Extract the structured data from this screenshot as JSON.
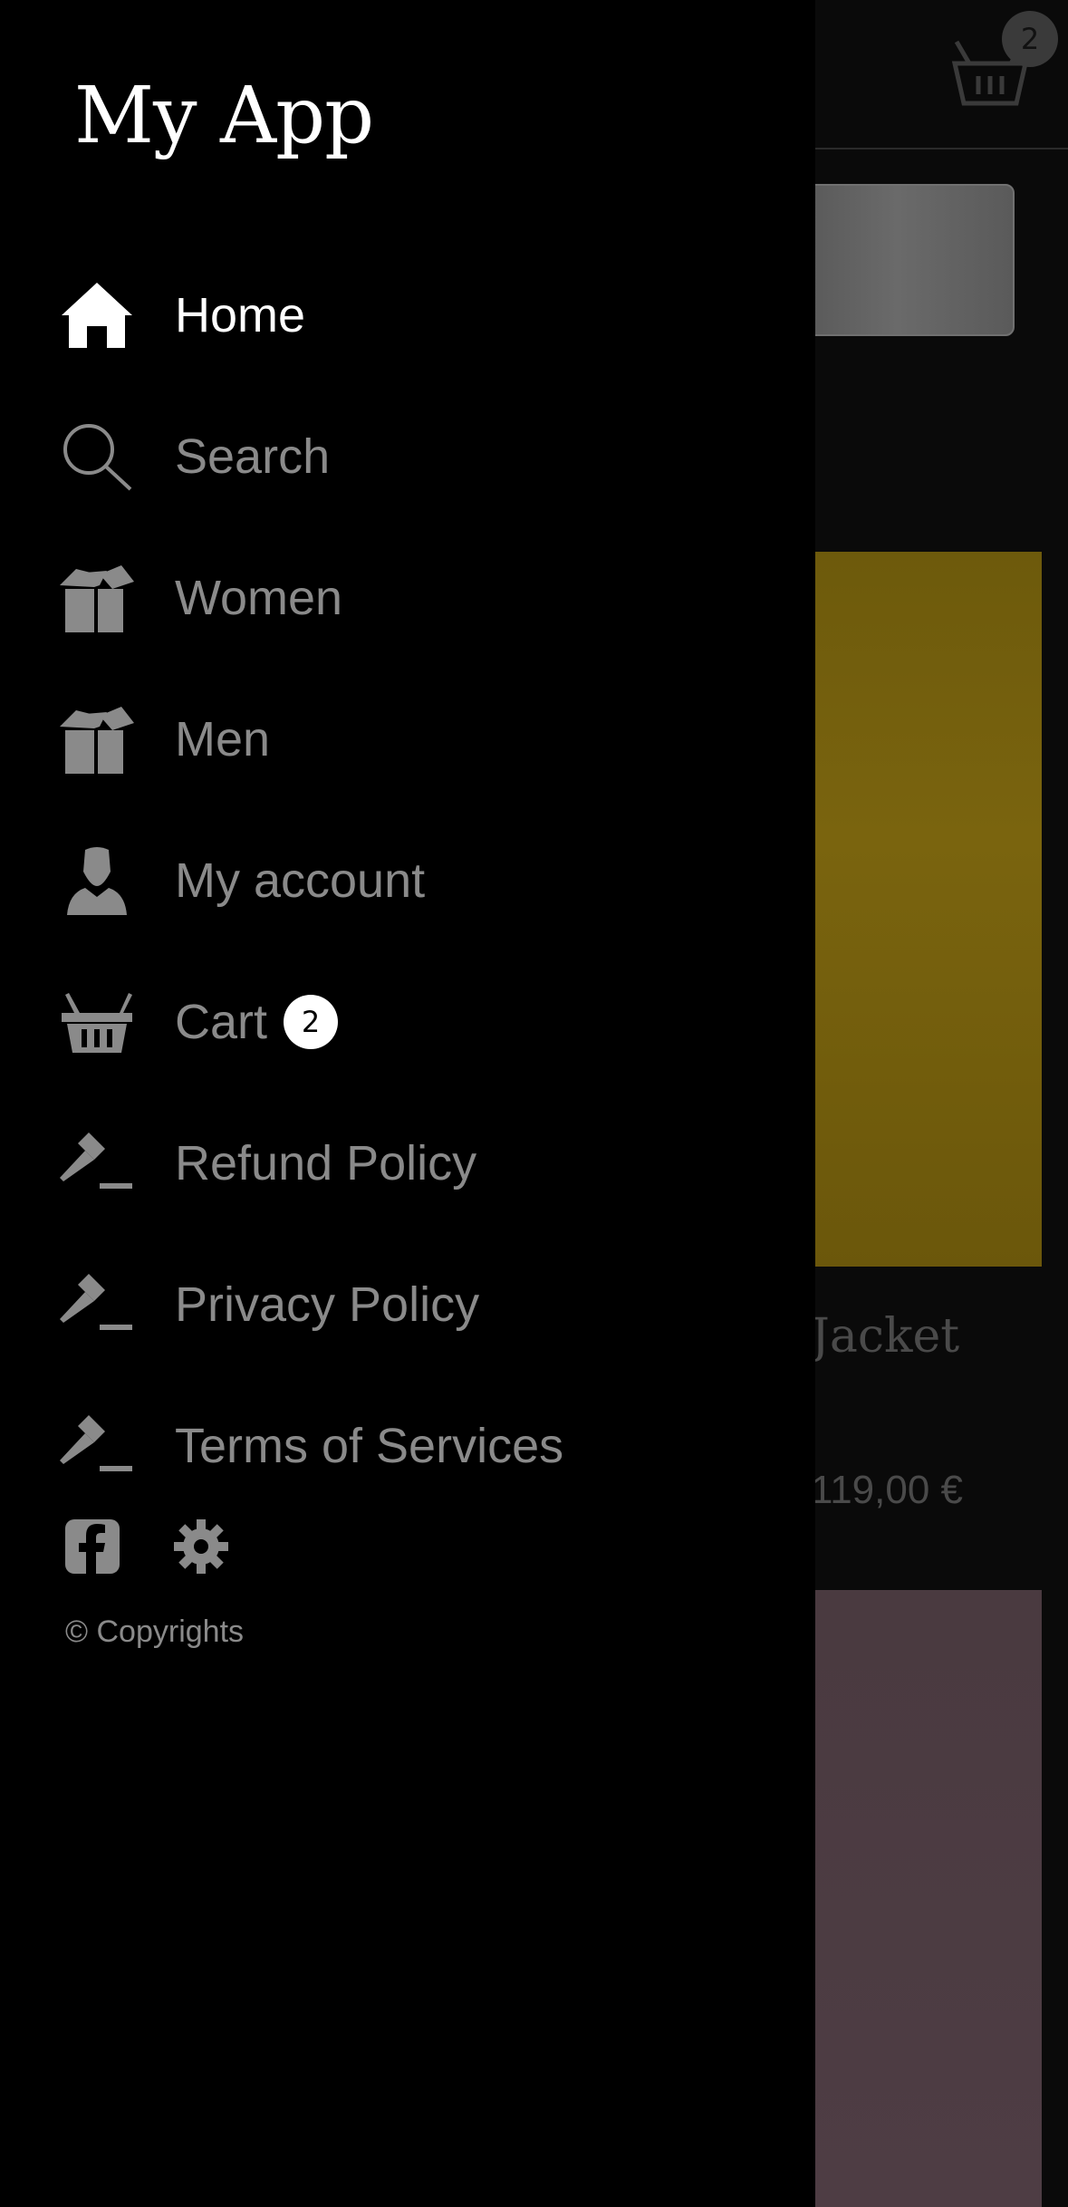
{
  "app": {
    "title": "My App"
  },
  "drawer": {
    "items": [
      {
        "label": "Home",
        "icon": "home-icon",
        "active": true
      },
      {
        "label": "Search",
        "icon": "search-icon"
      },
      {
        "label": "Women",
        "icon": "box-icon"
      },
      {
        "label": "Men",
        "icon": "box-icon"
      },
      {
        "label": "My account",
        "icon": "user-icon"
      },
      {
        "label": "Cart",
        "icon": "basket-icon",
        "badge": "2"
      },
      {
        "label": "Refund Policy",
        "icon": "gavel-icon"
      },
      {
        "label": "Privacy Policy",
        "icon": "gavel-icon"
      },
      {
        "label": "Terms of Services",
        "icon": "gavel-icon"
      }
    ],
    "footer": {
      "icons": [
        "facebook-icon",
        "gear-icon"
      ],
      "copyright": "© Copyrights"
    }
  },
  "background": {
    "cart_badge": "2",
    "product_title": "Jacket",
    "product_price": "119,00 €"
  },
  "colors": {
    "drawer_bg": "#000000",
    "active_text": "#ffffff",
    "inactive_text": "#8a8a8a",
    "badge_bg": "#ffffff"
  }
}
